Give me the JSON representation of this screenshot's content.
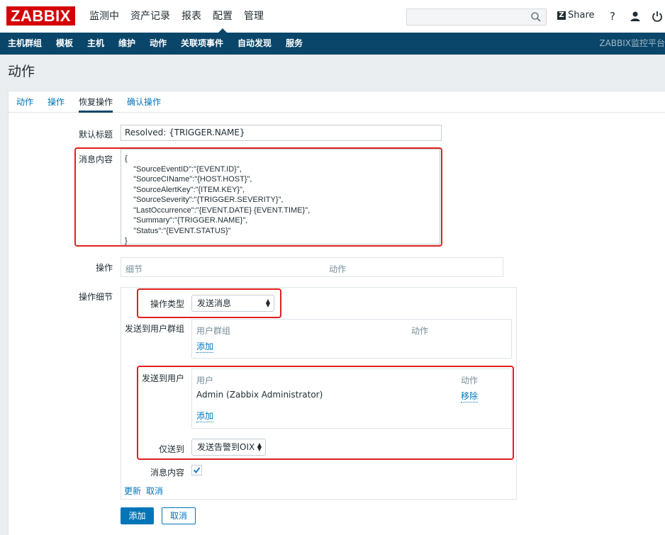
{
  "header": {
    "logo": "ZABBIX",
    "menu": [
      "监测中",
      "资产记录",
      "报表",
      "配置",
      "管理"
    ],
    "active_menu": "配置",
    "search_placeholder": "",
    "share_label": "Share",
    "help_label": "?"
  },
  "subnav": {
    "items": [
      "主机群组",
      "模板",
      "主机",
      "维护",
      "动作",
      "关联项事件",
      "自动发现",
      "服务"
    ],
    "brand": "ZABBIX监控平台"
  },
  "page_title": "动作",
  "tabs": [
    "动作",
    "操作",
    "恢复操作",
    "确认操作"
  ],
  "form": {
    "default_subject_label": "默认标题",
    "default_subject_value": "Resolved: {TRIGGER.NAME}",
    "message_label": "消息内容",
    "message_value": "{\n    \"SourceEventID\":\"{EVENT.ID}\",\n    \"SourceCIName\":\"{HOST.HOST}\",\n    \"SourceAlertKey\":\"{ITEM.KEY}\",\n    \"SourceSeverity\":\"{TRIGGER.SEVERITY}\",\n    \"LastOccurrence\":\"{EVENT.DATE} {EVENT.TIME}\",\n    \"Summary\":\"{TRIGGER.NAME}\",\n    \"Status\":\"{EVENT.STATUS}\"\n}",
    "operations_label": "操作",
    "operations_col_details": "细节",
    "operations_col_action": "动作",
    "op_details_label": "操作细节",
    "op_type_label": "操作类型",
    "op_type_value": "发送消息",
    "send_to_groups_label": "发送到用户群组",
    "groups_col_group": "用户群组",
    "groups_col_action": "动作",
    "groups_add": "添加",
    "send_to_users_label": "发送到用户",
    "users_col_user": "用户",
    "users_col_action": "动作",
    "users_row_name": "Admin (Zabbix Administrator)",
    "users_row_remove": "移除",
    "users_add": "添加",
    "send_only_to_label": "仅送到",
    "send_only_to_value": "发送告警到OIX",
    "message_content_label": "消息内容",
    "message_content_checked": true,
    "update_link": "更新",
    "cancel_link": "取消",
    "add_button": "添加",
    "cancel_button": "取消"
  },
  "colors": {
    "brand_red": "#d40000",
    "nav_blue": "#0a466a",
    "link_blue": "#0275b8",
    "highlight_red": "#e02020"
  }
}
